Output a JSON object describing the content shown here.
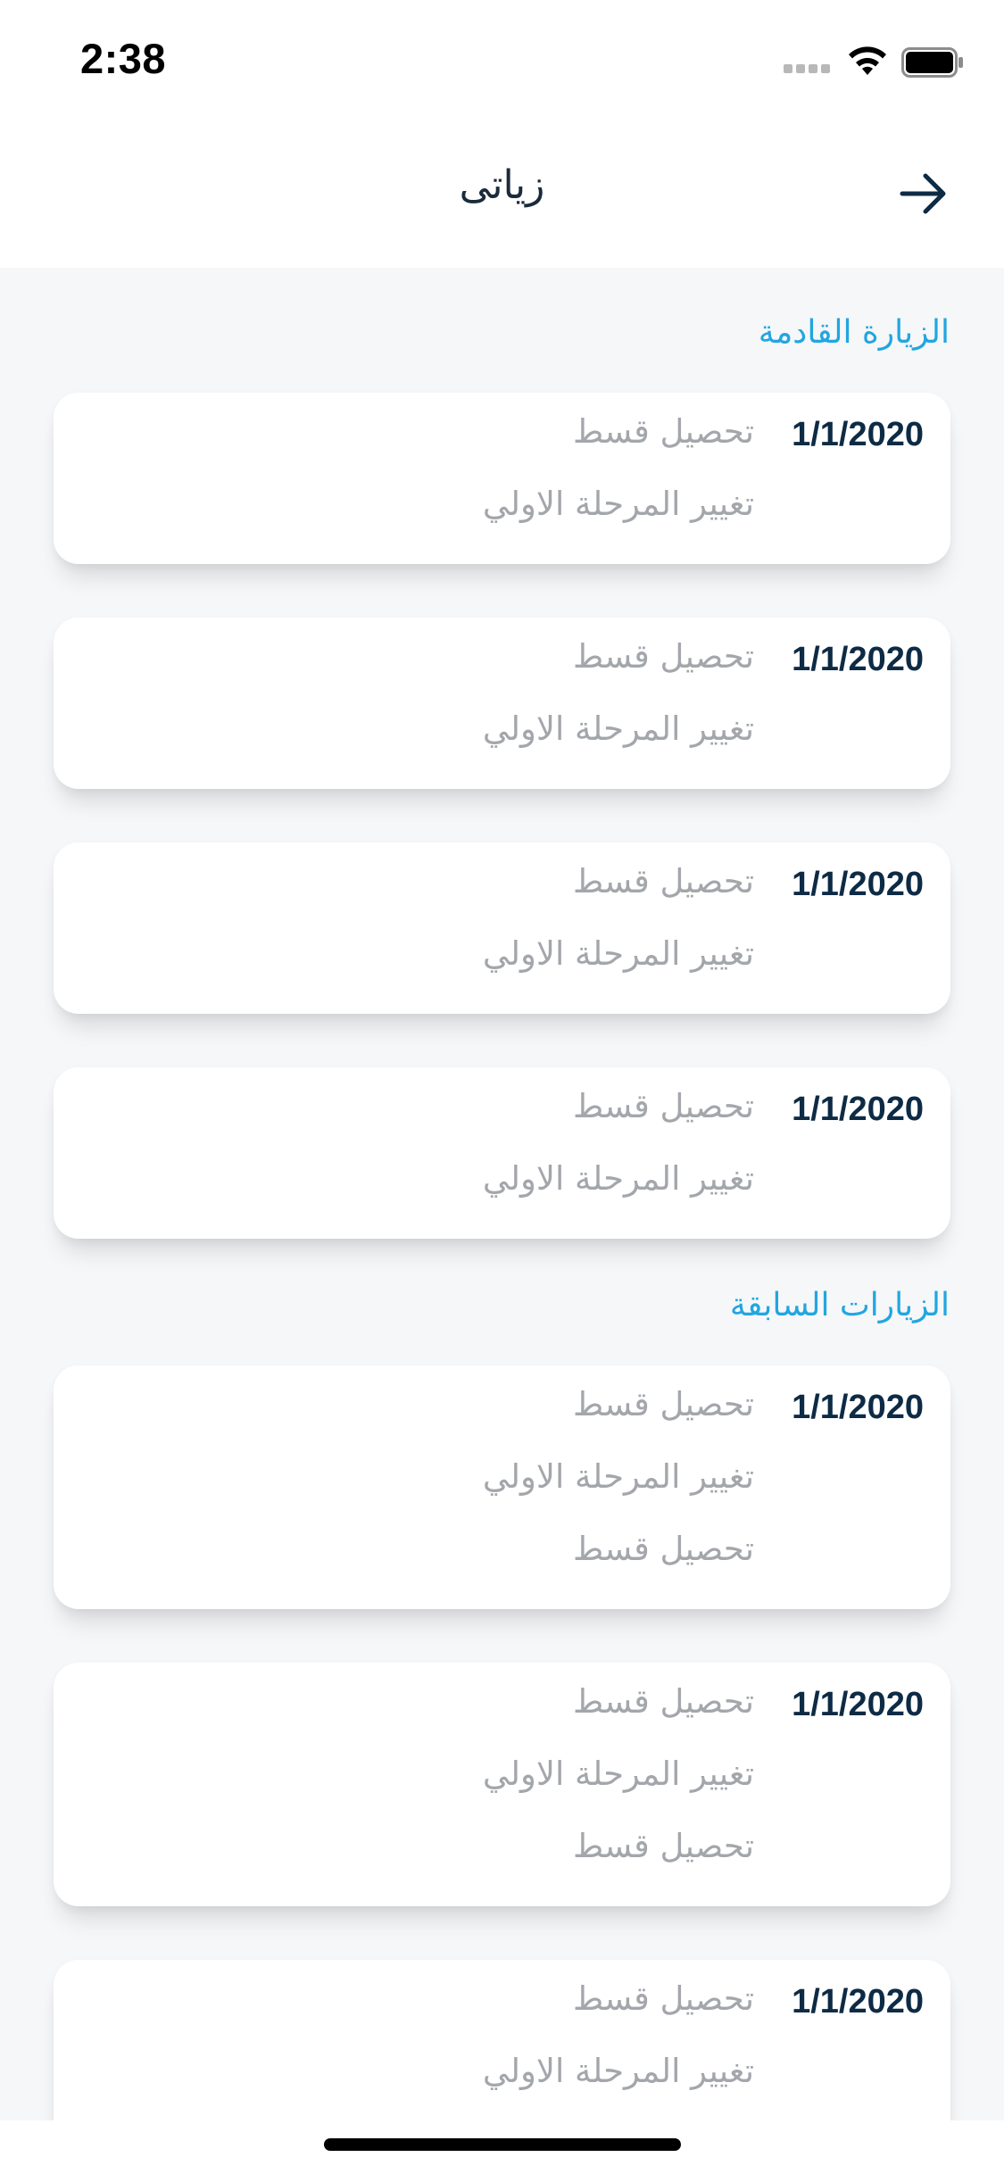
{
  "status_bar": {
    "time": "2:38"
  },
  "header": {
    "title": "زياتى",
    "back_icon": "arrow-right-icon"
  },
  "sections": {
    "upcoming": {
      "title": "الزيارة القادمة",
      "cards": [
        {
          "date": "1/1/2020",
          "lines": [
            "تحصيل قسط",
            "تغيير المرحلة الاولي"
          ]
        },
        {
          "date": "1/1/2020",
          "lines": [
            "تحصيل قسط",
            "تغيير المرحلة الاولي"
          ]
        },
        {
          "date": "1/1/2020",
          "lines": [
            "تحصيل قسط",
            "تغيير المرحلة الاولي"
          ]
        },
        {
          "date": "1/1/2020",
          "lines": [
            "تحصيل قسط",
            "تغيير المرحلة الاولي"
          ]
        }
      ]
    },
    "previous": {
      "title": "الزيارات السابقة",
      "cards": [
        {
          "date": "1/1/2020",
          "lines": [
            "تحصيل قسط",
            "تغيير المرحلة الاولي",
            "تحصيل قسط"
          ]
        },
        {
          "date": "1/1/2020",
          "lines": [
            "تحصيل قسط",
            "تغيير المرحلة الاولي",
            "تحصيل قسط"
          ]
        },
        {
          "date": "1/1/2020",
          "lines": [
            "تحصيل قسط",
            "تغيير المرحلة الاولي"
          ]
        }
      ]
    }
  },
  "colors": {
    "accent": "#21a6e0",
    "date_text": "#0e2b45",
    "secondary_text": "#a3a6ab",
    "background": "#f6f7f9"
  }
}
